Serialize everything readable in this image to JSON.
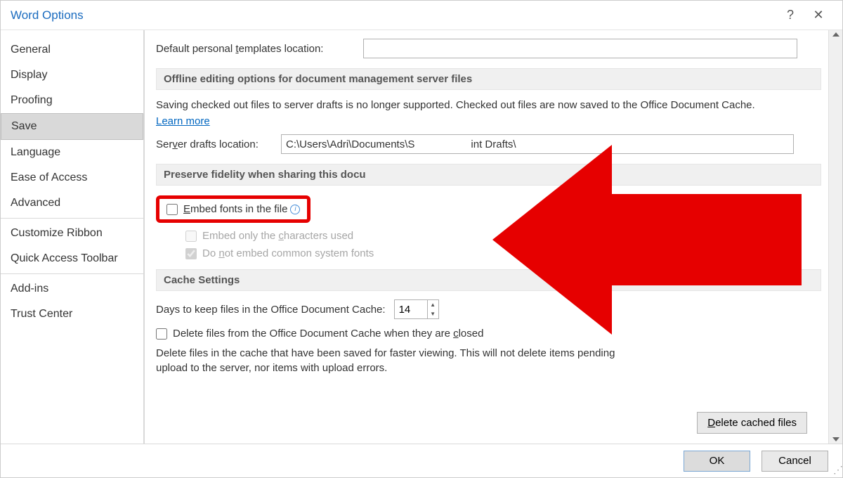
{
  "title": "Word Options",
  "sidebar": {
    "items": [
      "General",
      "Display",
      "Proofing",
      "Save",
      "Language",
      "Ease of Access",
      "Advanced",
      "Customize Ribbon",
      "Quick Access Toolbar",
      "Add-ins",
      "Trust Center"
    ],
    "selected_index": 3
  },
  "templates": {
    "label_pre": "Default personal ",
    "label_key": "t",
    "label_post": "emplates location:",
    "value": ""
  },
  "offline": {
    "heading": "Offline editing options for document management server files",
    "note": "Saving checked out files to server drafts is no longer supported. Checked out files are now saved to the Office Document Cache.",
    "learn_more": "Learn more",
    "drafts_label_pre": "Ser",
    "drafts_label_key": "v",
    "drafts_label_post": "er drafts location:",
    "drafts_value_pre": "C:\\Users\\Adri\\Documents\\S",
    "drafts_value_post": "int Drafts\\"
  },
  "preserve": {
    "heading_pre": "Preserve fidelity when sharing this docu",
    "embed_pre": "E",
    "embed_post": "mbed fonts in the file",
    "only_pre": "Embed only the ",
    "only_key": "c",
    "only_post": "haracters used",
    "common_pre": "Do ",
    "common_key": "n",
    "common_post": "ot embed common system fonts"
  },
  "cache": {
    "heading": "Cache Settings",
    "days_label": "Days to keep files in the Office Document Cache:",
    "days_value": "14",
    "delete_on_close_pre": "Delete files from the Office Document Cache when they are ",
    "delete_on_close_key": "c",
    "delete_on_close_post": "losed",
    "info": "Delete files in the cache that have been saved for faster viewing. This will not delete items pending upload to the server, nor items with upload errors.",
    "delete_btn_pre": "D",
    "delete_btn_post": "elete cached files"
  },
  "footer": {
    "ok": "OK",
    "cancel": "Cancel"
  }
}
